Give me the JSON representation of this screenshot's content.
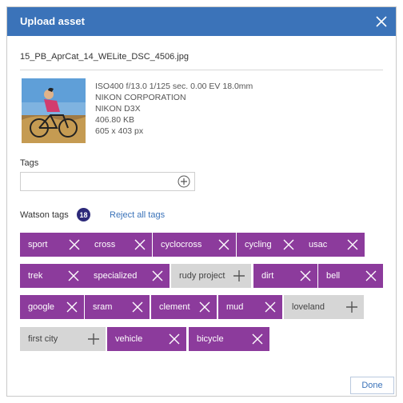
{
  "dialog": {
    "title": "Upload asset",
    "filename": "15_PB_AprCat_14_WELite_DSC_4506.jpg",
    "metadata": [
      "ISO400 f/13.0 1/125 sec. 0.00 EV 18.0mm",
      "NIKON CORPORATION",
      "NIKON D3X",
      "406.80 KB",
      "605 x 403 px"
    ],
    "tags_label": "Tags",
    "tags_input_value": "",
    "tags_input_placeholder": "",
    "watson_label": "Watson tags",
    "watson_count": "18",
    "reject_all_label": "Reject all tags",
    "done_label": "Done"
  },
  "watson_tags": [
    {
      "label": "sport",
      "state": "accepted"
    },
    {
      "label": "cross",
      "state": "accepted"
    },
    {
      "label": "cyclocross",
      "state": "accepted"
    },
    {
      "label": "cycling",
      "state": "accepted"
    },
    {
      "label": "usac",
      "state": "accepted"
    },
    {
      "label": "trek",
      "state": "accepted"
    },
    {
      "label": "specialized",
      "state": "accepted"
    },
    {
      "label": "rudy project",
      "state": "rejected"
    },
    {
      "label": "dirt",
      "state": "accepted"
    },
    {
      "label": "bell",
      "state": "accepted"
    },
    {
      "label": "google",
      "state": "accepted"
    },
    {
      "label": "sram",
      "state": "accepted"
    },
    {
      "label": "clement",
      "state": "accepted"
    },
    {
      "label": "mud",
      "state": "accepted"
    },
    {
      "label": "loveland",
      "state": "rejected"
    },
    {
      "label": "first city",
      "state": "rejected"
    },
    {
      "label": "vehicle",
      "state": "accepted"
    },
    {
      "label": "bicycle",
      "state": "accepted"
    }
  ],
  "colors": {
    "titlebar": "#3b73b9",
    "accepted_chip": "#8c3b9c",
    "rejected_chip": "#d6d6d6",
    "count_badge": "#2d2a7a",
    "link": "#3b73b9"
  },
  "icons": {
    "close": "close-icon",
    "add": "plus-circle-icon",
    "remove_tag": "x-icon",
    "add_tag": "plus-icon"
  }
}
